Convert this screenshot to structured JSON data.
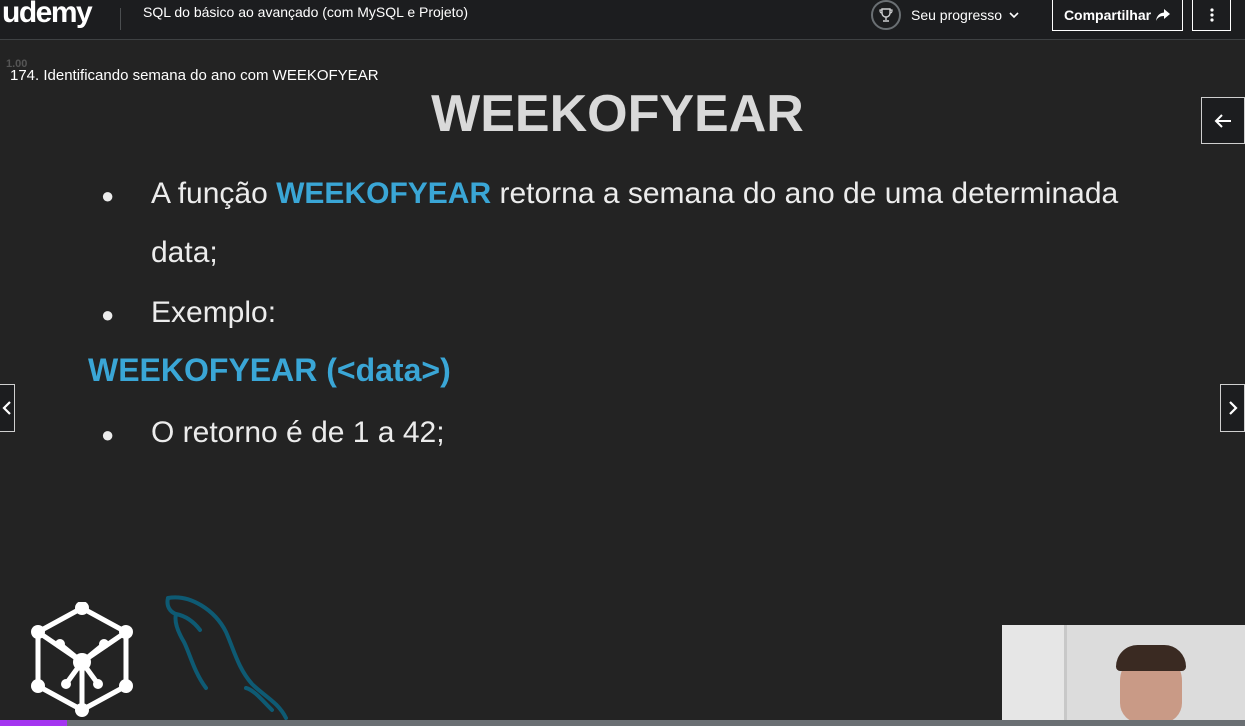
{
  "header": {
    "logo": "udemy",
    "course_title": "SQL do básico ao avançado (com MySQL e Projeto)",
    "progress_label": "Seu progresso",
    "share_label": "Compartilhar"
  },
  "player": {
    "speed_hint": "1.00",
    "lecture_title": "174. Identificando semana do ano com WEEKOFYEAR",
    "playback_progress_fraction": 0.054
  },
  "slide": {
    "title": "WEEKOFYEAR",
    "bullet1": {
      "before": "A função ",
      "highlight": "WEEKOFYEAR",
      "after": " retorna a semana do ano de uma determinada",
      "line2": "data;"
    },
    "bullet2": "Exemplo:",
    "syntax": "WEEKOFYEAR (<data>)",
    "bullet3": "O retorno é de 1 a 42;",
    "bullet_symbol": "●"
  },
  "colors": {
    "accent_blue": "#3aa6d6",
    "udemy_purple": "#a435f0"
  },
  "icons": [
    "trophy-icon",
    "chevron-down-icon",
    "share-arrow-icon",
    "kebab-menu-icon",
    "arrow-left-icon",
    "chevron-left-icon",
    "chevron-right-icon",
    "network-cube-logo",
    "mysql-dolphin-logo"
  ]
}
